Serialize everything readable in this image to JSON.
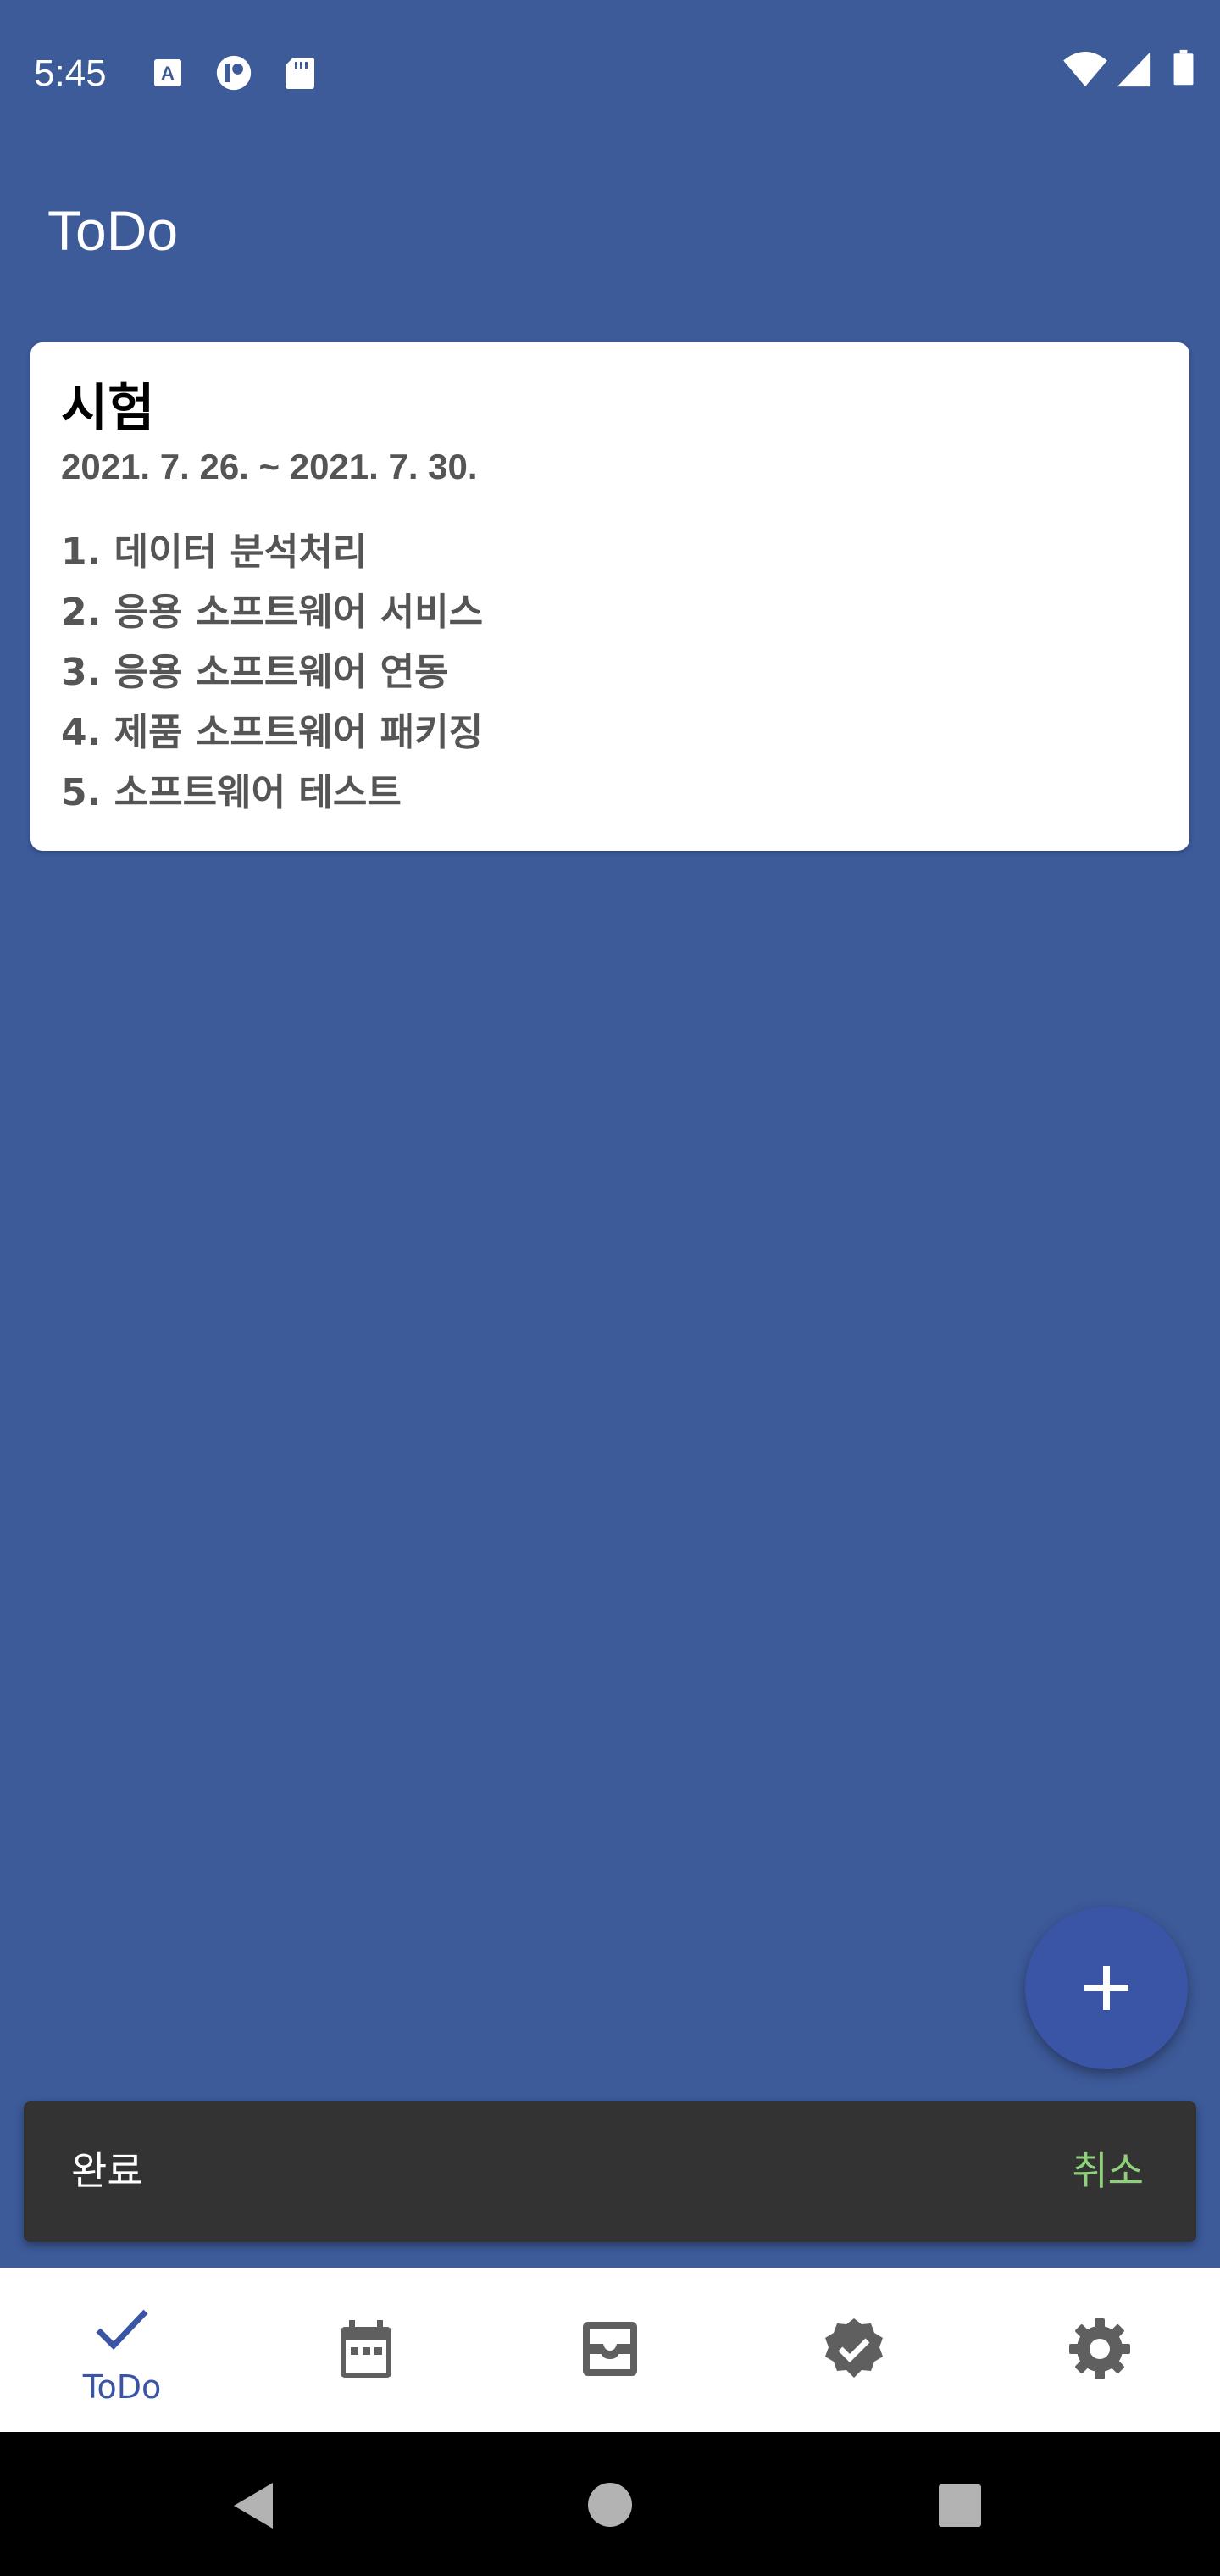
{
  "status_bar": {
    "time": "5:45",
    "left_icons": [
      "font-a-icon",
      "media-icon",
      "sd-card-icon"
    ],
    "right_icons": [
      "wifi-icon",
      "cell-signal-icon",
      "battery-icon"
    ]
  },
  "app_bar": {
    "title": "ToDo"
  },
  "card": {
    "title": "시험",
    "dates": "2021. 7. 26. ~ 2021. 7. 30.",
    "items": [
      "1. 데이터 분석처리",
      "2. 응용 소프트웨어 서비스",
      "3. 응용 소프트웨어 연동",
      "4. 제품 소프트웨어 패키징",
      "5. 소프트웨어 테스트"
    ]
  },
  "fab": {
    "icon": "plus-icon"
  },
  "snackbar": {
    "message": "완료",
    "action": "취소"
  },
  "bottom_nav": {
    "items": [
      {
        "label": "ToDo",
        "icon": "check-icon",
        "active": true
      },
      {
        "label": "",
        "icon": "calendar-icon",
        "active": false
      },
      {
        "label": "",
        "icon": "inbox-icon",
        "active": false
      },
      {
        "label": "",
        "icon": "verified-badge-icon",
        "active": false
      },
      {
        "label": "",
        "icon": "gear-icon",
        "active": false
      }
    ]
  },
  "colors": {
    "background": "#3d5a99",
    "primary": "#3b55a6",
    "snackbar": "#333333",
    "snackbar_action": "#8fd17a",
    "inactive_icon": "#5f5f5f"
  }
}
